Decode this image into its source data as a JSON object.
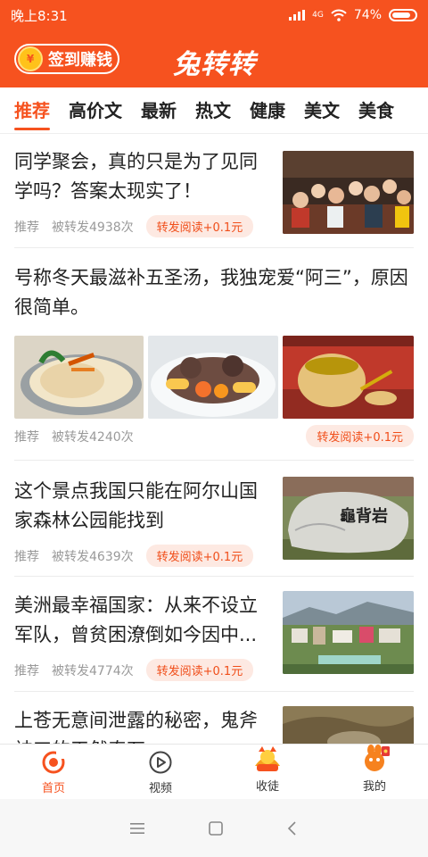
{
  "status": {
    "time": "晚上8:31",
    "signal_label": "4G",
    "battery": "74%"
  },
  "header": {
    "signin_label": "签到赚钱",
    "coin_glyph": "¥",
    "title": "兔转转"
  },
  "tabs": [
    {
      "label": "推荐",
      "active": true
    },
    {
      "label": "高价文"
    },
    {
      "label": "最新"
    },
    {
      "label": "热文"
    },
    {
      "label": "健康"
    },
    {
      "label": "美文"
    },
    {
      "label": "美食"
    }
  ],
  "articles": [
    {
      "title": "同学聚会，真的只是为了见同学吗？答案太现实了！",
      "category": "推荐",
      "shares": "被转发4938次",
      "reward": "转发阅读+0.1元"
    },
    {
      "title": "号称冬天最滋补五圣汤，我独宠爱“阿三”，原因很简单。",
      "category": "推荐",
      "shares": "被转发4240次",
      "reward": "转发阅读+0.1元"
    },
    {
      "title": "这个景点我国只能在阿尔山国家森林公园能找到",
      "category": "推荐",
      "shares": "被转发4639次",
      "reward": "转发阅读+0.1元",
      "stone_text": "龜背岩"
    },
    {
      "title": "美洲最幸福国家：从来不设立军队，曾贫困潦倒如今因中...",
      "category": "推荐",
      "shares": "被转发4774次",
      "reward": "转发阅读+0.1元"
    },
    {
      "title": "上苍无意间泄露的秘密，鬼斧神工的天然奇石"
    }
  ],
  "bottom_nav": [
    {
      "label": "首页",
      "icon": "home-icon",
      "active": true
    },
    {
      "label": "视频",
      "icon": "video-play-icon"
    },
    {
      "label": "收徒",
      "icon": "apprentice-icon"
    },
    {
      "label": "我的",
      "icon": "profile-icon"
    }
  ],
  "colors": {
    "brand": "#f6521f",
    "reward_bg": "#fde9e2",
    "muted": "#9a9a9a"
  }
}
